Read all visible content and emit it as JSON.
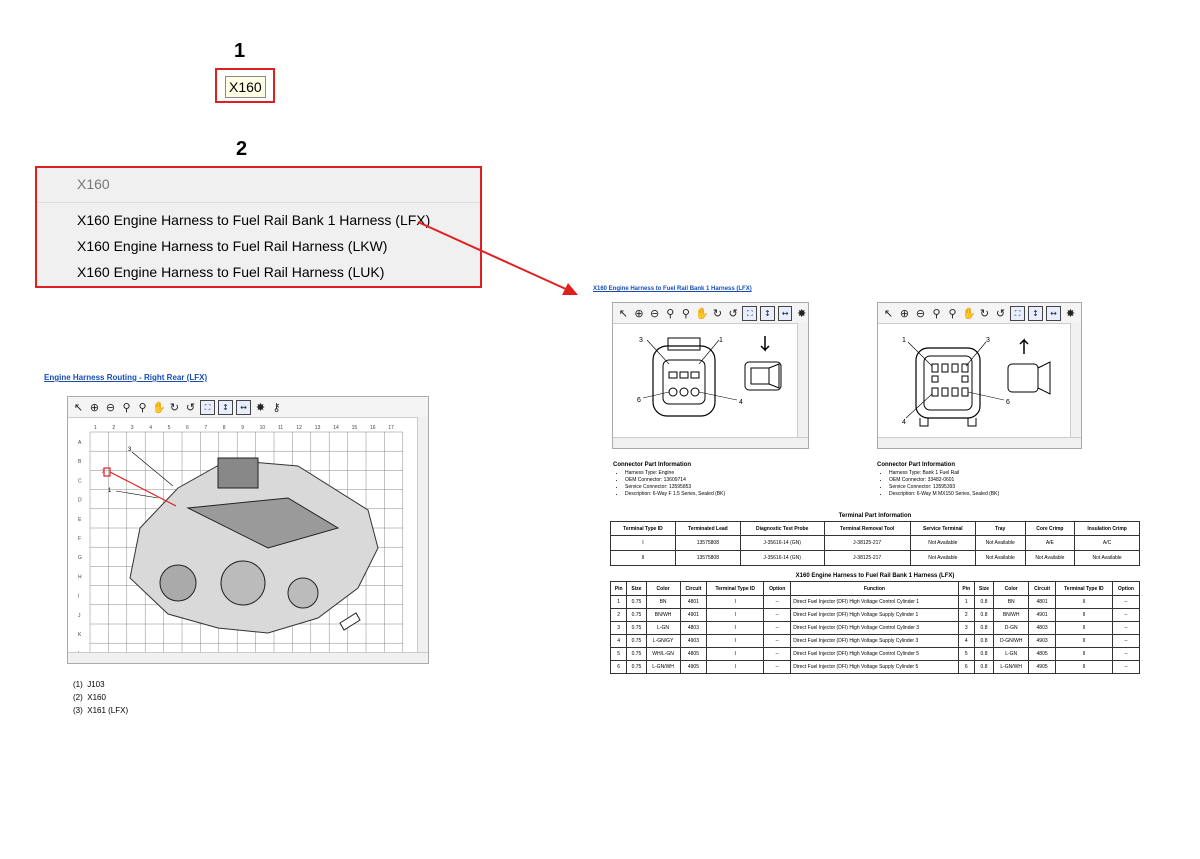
{
  "callouts": {
    "one": "1",
    "two": "2"
  },
  "chip": {
    "label": "X160"
  },
  "dropdown": {
    "header": "X160",
    "items": [
      "X160 Engine Harness to Fuel Rail Bank 1 Harness (LFX)",
      "X160 Engine Harness to Fuel Rail Harness (LKW)",
      "X160 Engine Harness to Fuel Rail Harness (LUK)"
    ]
  },
  "left_doc": {
    "link": "Engine Harness Routing - Right Rear (LFX)",
    "col_numbers": [
      "1",
      "2",
      "3",
      "4",
      "5",
      "6",
      "7",
      "8",
      "9",
      "10",
      "11",
      "12",
      "13",
      "14",
      "15",
      "16",
      "17"
    ],
    "row_letters": [
      "A",
      "B",
      "C",
      "D",
      "E",
      "F",
      "G",
      "H",
      "I",
      "J",
      "K",
      "L"
    ],
    "callout_labels": [
      "1",
      "2",
      "3"
    ],
    "legend": [
      {
        "num": "(1)",
        "text": "J103"
      },
      {
        "num": "(2)",
        "text": "X160"
      },
      {
        "num": "(3)",
        "text": "X161 (LFX)"
      }
    ]
  },
  "right_doc": {
    "link": "X160 Engine Harness to Fuel Rail Bank 1 Harness (LFX)",
    "conn1": {
      "pins": [
        "3",
        "1",
        "6",
        "4"
      ],
      "info_title": "Connector Part Information",
      "info": [
        "Harness Type: Engine",
        "OEM Connector: 13609714",
        "Service Connector: 13595853",
        "Description: 6-Way F 1.5 Series, Sealed (BK)"
      ]
    },
    "conn2": {
      "pins": [
        "1",
        "3",
        "4",
        "6"
      ],
      "info_title": "Connector Part Information",
      "info": [
        "Harness Type: Bank 1 Fuel Rail",
        "OEM Connector: 33482-0601",
        "Service Connector: 13595393",
        "Description: 6-Way M MX150 Series, Sealed (BK)"
      ]
    },
    "terminal_title": "Terminal Part Information",
    "terminal_headers": [
      "Terminal Type ID",
      "Terminated Lead",
      "Diagnostic Test Probe",
      "Terminal Removal Tool",
      "Service Terminal",
      "Tray",
      "Core Crimp",
      "Insulation Crimp"
    ],
    "terminal_rows": [
      [
        "I",
        "13575808",
        "J-35616-14 (GN)",
        "J-38125-217",
        "Not Available",
        "Not Available",
        "A/E",
        "A/C"
      ],
      [
        "II",
        "13575808",
        "J-35616-14 (GN)",
        "J-38125-217",
        "Not Available",
        "Not Available",
        "Not Available",
        "Not Available"
      ]
    ],
    "pin_title": "X160 Engine Harness to Fuel Rail Bank 1 Harness (LFX)",
    "pin_headers": [
      "Pin",
      "Size",
      "Color",
      "Circuit",
      "Terminal Type ID",
      "Option",
      "Function",
      "Pin",
      "Size",
      "Color",
      "Circuit",
      "Terminal Type ID",
      "Option"
    ],
    "pin_rows": [
      [
        "1",
        "0.75",
        "BN",
        "4801",
        "I",
        "--",
        "Direct Fuel Injector (DFI) High Voltage Control Cylinder 1",
        "1",
        "0.8",
        "BN",
        "4801",
        "II",
        "--"
      ],
      [
        "2",
        "0.75",
        "BN/WH",
        "4901",
        "I",
        "--",
        "Direct Fuel Injector (DFI) High Voltage Supply Cylinder 1",
        "2",
        "0.8",
        "BN/WH",
        "4901",
        "II",
        "--"
      ],
      [
        "3",
        "0.75",
        "L-GN",
        "4803",
        "I",
        "--",
        "Direct Fuel Injector (DFI) High Voltage Control Cylinder 3",
        "3",
        "0.8",
        "D-GN",
        "4803",
        "II",
        "--"
      ],
      [
        "4",
        "0.75",
        "L-GN/GY",
        "4903",
        "I",
        "--",
        "Direct Fuel Injector (DFI) High Voltage Supply Cylinder 3",
        "4",
        "0.8",
        "D-GN/WH",
        "4903",
        "II",
        "--"
      ],
      [
        "5",
        "0.75",
        "WH/L-GN",
        "4805",
        "I",
        "--",
        "Direct Fuel Injector (DFI) High Voltage Control Cylinder 5",
        "5",
        "0.8",
        "L-GN",
        "4805",
        "II",
        "--"
      ],
      [
        "6",
        "0.75",
        "L-GN/WH",
        "4905",
        "I",
        "--",
        "Direct Fuel Injector (DFI) High Voltage Supply Cylinder 5",
        "6",
        "0.8",
        "L-GN/WH",
        "4905",
        "II",
        "--"
      ]
    ]
  },
  "colors": {
    "callout_red": "#e02020",
    "link_blue": "#1a4db3"
  }
}
